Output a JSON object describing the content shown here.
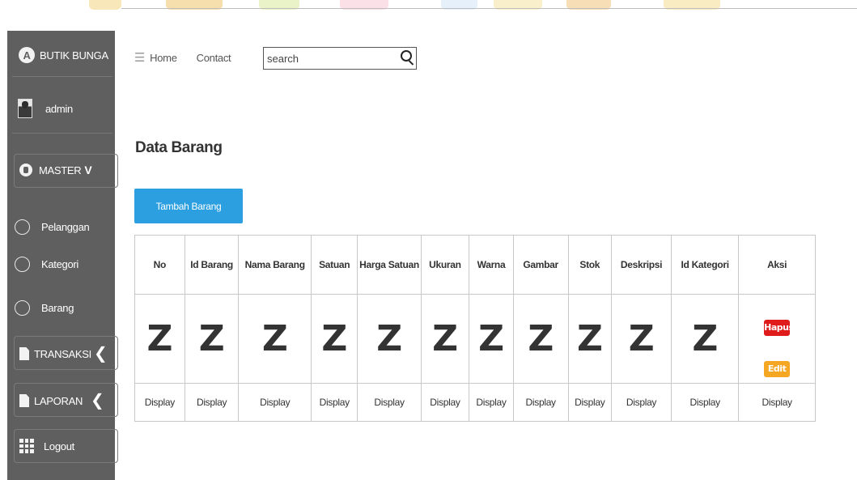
{
  "sidebar": {
    "brand": "BUTIK BUNGA",
    "user": "admin",
    "master_label": "MASTER",
    "master_items": [
      "Pelanggan",
      "Kategori",
      "Barang"
    ],
    "transaksi_label": "TRANSAKSI",
    "laporan_label": "LAPORAN",
    "logout_label": "Logout"
  },
  "nav": {
    "home": "Home",
    "contact": "Contact",
    "search_value": "search"
  },
  "page": {
    "title": "Data Barang",
    "add_button": "Tambah Barang"
  },
  "table": {
    "headers": [
      "No",
      "Id Barang",
      "Nama Barang",
      "Satuan",
      "Harga Satuan",
      "Ukuran",
      "Warna",
      "Gambar",
      "Stok",
      "Deskripsi",
      "Id Kategori",
      "Aksi"
    ],
    "placeholder_glyph": "Z",
    "display_label": "Display",
    "delete_button": "Hapus",
    "edit_button": "Edit"
  },
  "colors": {
    "sidebar_bg": "#5f5f5f",
    "primary_button": "#2b9fe0",
    "delete_button": "#e01b1b",
    "edit_button": "#f5a623"
  }
}
